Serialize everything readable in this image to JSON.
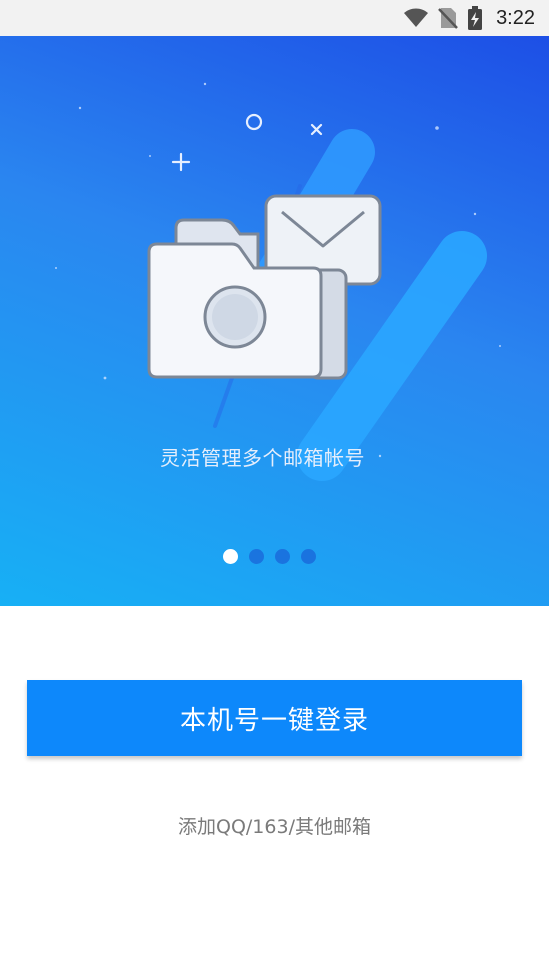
{
  "status_bar": {
    "time": "3:22",
    "icons": [
      "wifi-icon",
      "no-sim-icon",
      "battery-charging-icon"
    ]
  },
  "onboarding": {
    "caption": "灵活管理多个邮箱帐号",
    "illustration": "folder-and-envelope-illustration",
    "pager": {
      "total_pages": 4,
      "active_page": 1
    }
  },
  "actions": {
    "login_button": "本机号一键登录",
    "add_other_link": "添加QQ/163/其他邮箱"
  },
  "colors": {
    "primary": "#0d88fb",
    "hero_gradient_top": "#1d4fe6",
    "hero_gradient_bottom": "#17b0f5",
    "link_text": "#7a7a7a"
  }
}
